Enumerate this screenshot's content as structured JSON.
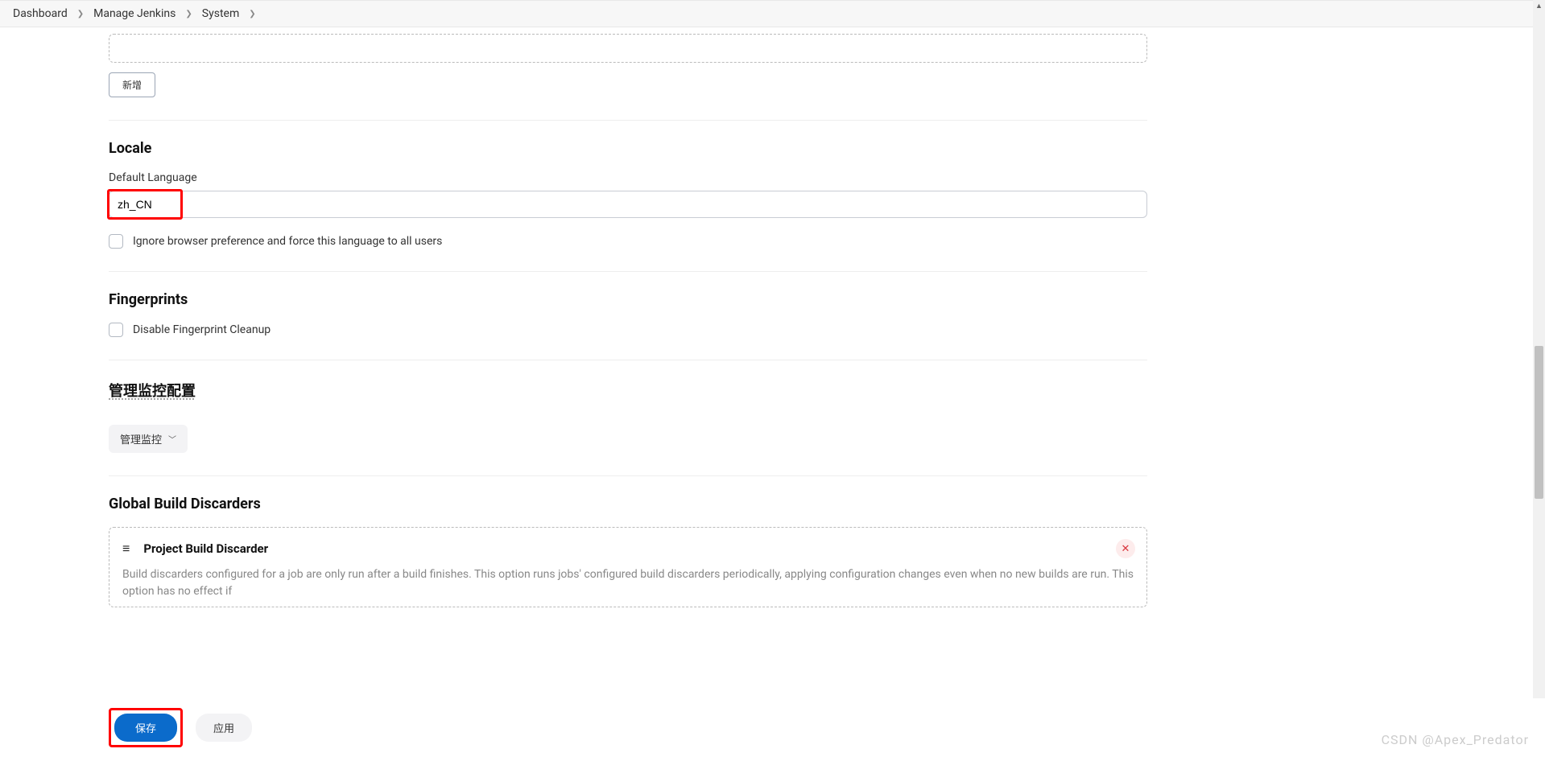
{
  "breadcrumb": {
    "items": [
      "Dashboard",
      "Manage Jenkins",
      "System"
    ]
  },
  "add_button_label": "新增",
  "locale": {
    "title": "Locale",
    "default_language_label": "Default Language",
    "default_language_value": "zh_CN",
    "ignore_browser_label": "Ignore browser preference and force this language to all users"
  },
  "fingerprints": {
    "title": "Fingerprints",
    "disable_cleanup_label": "Disable Fingerprint Cleanup"
  },
  "monitor": {
    "title": "管理监控配置",
    "dropdown_label": "管理监控"
  },
  "global_discarders": {
    "title": "Global Build Discarders",
    "item_title": "Project Build Discarder",
    "item_desc": "Build discarders configured for a job are only run after a build finishes. This option runs jobs' configured build discarders periodically, applying configuration changes even when no new builds are run. This option has no effect if"
  },
  "footer": {
    "save_label": "保存",
    "apply_label": "应用"
  },
  "watermark": "CSDN @Apex_Predator"
}
